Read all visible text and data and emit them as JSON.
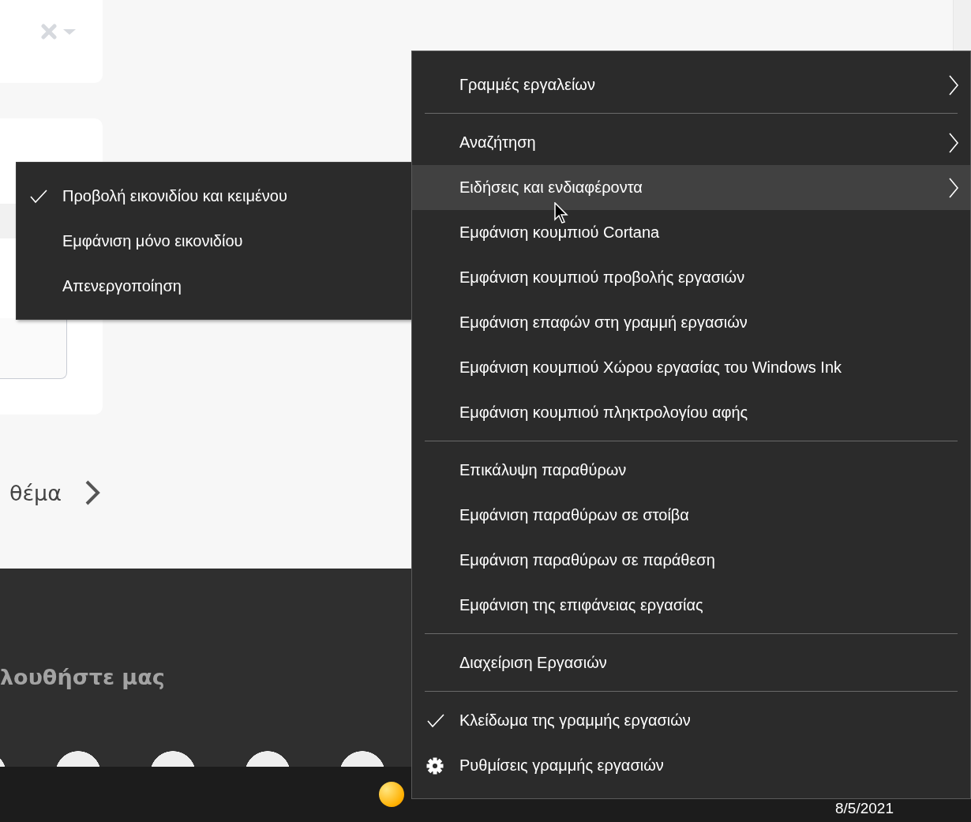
{
  "page": {
    "topic_link": "θέμα",
    "footer_heading": "λουθήστε μας"
  },
  "submenu": {
    "items": [
      {
        "label": "Προβολή εικονιδίου και κειμένου",
        "checked": true
      },
      {
        "label": "Εμφάνιση μόνο εικονιδίου",
        "checked": false
      },
      {
        "label": "Απενεργοποίηση",
        "checked": false
      }
    ]
  },
  "context_menu": {
    "items": [
      {
        "kind": "option",
        "label": "Γραμμές εργαλείων",
        "submenu": true,
        "checked": false,
        "selected": false
      },
      {
        "kind": "separator"
      },
      {
        "kind": "option",
        "label": "Αναζήτηση",
        "submenu": true,
        "checked": false,
        "selected": false
      },
      {
        "kind": "option",
        "label": "Ειδήσεις και ενδιαφέροντα",
        "submenu": true,
        "checked": false,
        "selected": true
      },
      {
        "kind": "option",
        "label": "Εμφάνιση κουμπιού Cortana",
        "submenu": false,
        "checked": false,
        "selected": false
      },
      {
        "kind": "option",
        "label": "Εμφάνιση κουμπιού προβολής εργασιών",
        "submenu": false,
        "checked": false,
        "selected": false
      },
      {
        "kind": "option",
        "label": "Εμφάνιση επαφών στη γραμμή εργασιών",
        "submenu": false,
        "checked": false,
        "selected": false
      },
      {
        "kind": "option",
        "label": "Εμφάνιση κουμπιού Χώρου εργασίας του Windows Ink",
        "submenu": false,
        "checked": false,
        "selected": false
      },
      {
        "kind": "option",
        "label": "Εμφάνιση κουμπιού πληκτρολογίου αφής",
        "submenu": false,
        "checked": false,
        "selected": false
      },
      {
        "kind": "separator"
      },
      {
        "kind": "option",
        "label": "Επικάλυψη παραθύρων",
        "submenu": false,
        "checked": false,
        "selected": false
      },
      {
        "kind": "option",
        "label": "Εμφάνιση παραθύρων σε στοίβα",
        "submenu": false,
        "checked": false,
        "selected": false
      },
      {
        "kind": "option",
        "label": "Εμφάνιση παραθύρων σε παράθεση",
        "submenu": false,
        "checked": false,
        "selected": false
      },
      {
        "kind": "option",
        "label": "Εμφάνιση της επιφάνειας εργασίας",
        "submenu": false,
        "checked": false,
        "selected": false
      },
      {
        "kind": "separator"
      },
      {
        "kind": "option",
        "label": "Διαχείριση Εργασιών",
        "submenu": false,
        "checked": false,
        "selected": false
      },
      {
        "kind": "separator"
      },
      {
        "kind": "option",
        "label": "Κλείδωμα της γραμμής εργασιών",
        "submenu": false,
        "checked": true,
        "selected": false
      },
      {
        "kind": "settings",
        "label": "Ρυθμίσεις γραμμής εργασιών",
        "submenu": false,
        "selected": false
      }
    ]
  },
  "taskbar": {
    "date": "8/5/2021"
  }
}
